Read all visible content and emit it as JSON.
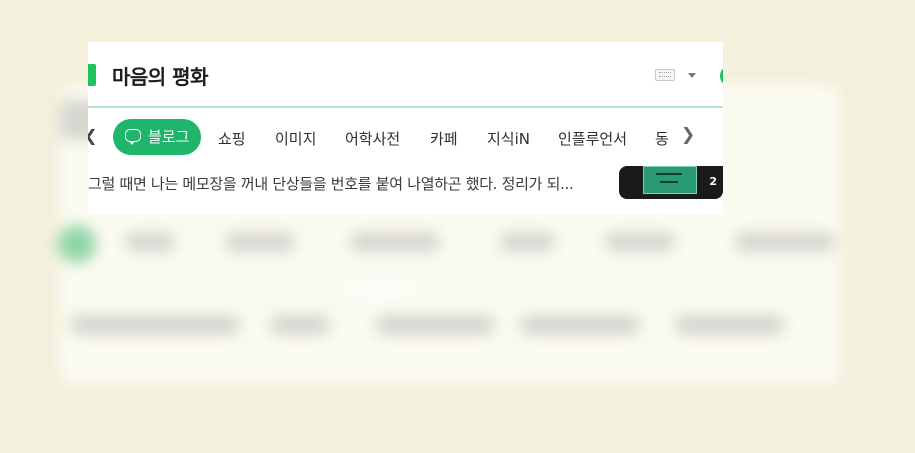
{
  "search": {
    "query": "마음의 평화"
  },
  "tabs": {
    "active": "블로그",
    "items": [
      "쇼핑",
      "이미지",
      "어학사전",
      "카페",
      "지식iN",
      "인플루언서",
      "동"
    ]
  },
  "result": {
    "snippet": "그럴 때면 나는 메모장을 꺼내 단상들을 번호를 붙여 나열하곤 했다. 정리가 되...",
    "thumb_count": "2"
  },
  "background": {
    "blurred_text": "바람돌이"
  },
  "colors": {
    "accent": "#1fb56b",
    "page_bg": "#f3f1dc"
  }
}
